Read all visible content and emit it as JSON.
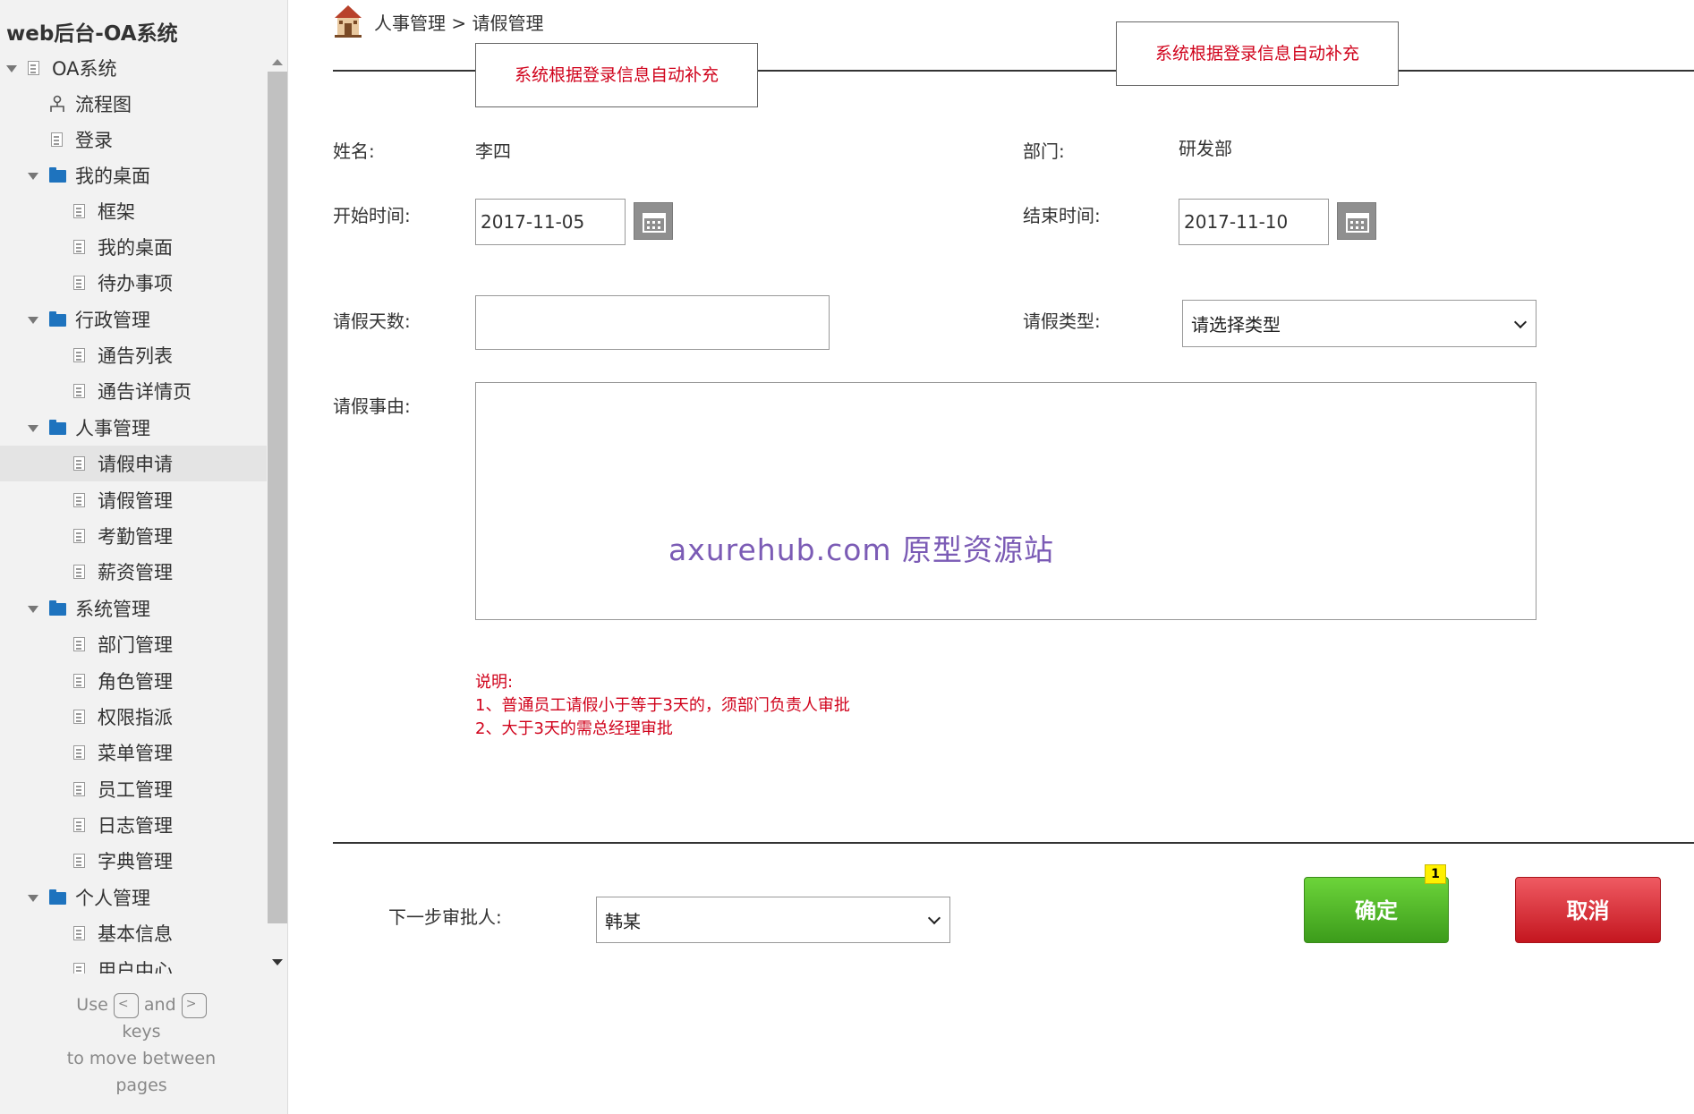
{
  "sidebar": {
    "app_title": "web后台-OA系统",
    "items": [
      {
        "label": "OA系统",
        "icon": "document-icon",
        "expander": "expanded"
      },
      {
        "label": "流程图",
        "icon": "flowchart-icon"
      },
      {
        "label": "登录",
        "icon": "document-icon"
      },
      {
        "label": "我的桌面",
        "icon": "folder-icon",
        "expander": "expanded"
      },
      {
        "label": "框架",
        "icon": "document-icon"
      },
      {
        "label": "我的桌面",
        "icon": "document-icon"
      },
      {
        "label": "待办事项",
        "icon": "document-icon"
      },
      {
        "label": "行政管理",
        "icon": "folder-icon",
        "expander": "expanded"
      },
      {
        "label": "通告列表",
        "icon": "document-icon"
      },
      {
        "label": "通告详情页",
        "icon": "document-icon"
      },
      {
        "label": "人事管理",
        "icon": "folder-icon",
        "expander": "expanded"
      },
      {
        "label": "请假申请",
        "icon": "document-icon",
        "selected": true
      },
      {
        "label": "请假管理",
        "icon": "document-icon"
      },
      {
        "label": "考勤管理",
        "icon": "document-icon"
      },
      {
        "label": "薪资管理",
        "icon": "document-icon"
      },
      {
        "label": "系统管理",
        "icon": "folder-icon",
        "expander": "expanded"
      },
      {
        "label": "部门管理",
        "icon": "document-icon"
      },
      {
        "label": "角色管理",
        "icon": "document-icon"
      },
      {
        "label": "权限指派",
        "icon": "document-icon"
      },
      {
        "label": "菜单管理",
        "icon": "document-icon"
      },
      {
        "label": "员工管理",
        "icon": "document-icon"
      },
      {
        "label": "日志管理",
        "icon": "document-icon"
      },
      {
        "label": "字典管理",
        "icon": "document-icon"
      },
      {
        "label": "个人管理",
        "icon": "folder-icon",
        "expander": "expanded"
      },
      {
        "label": "基本信息",
        "icon": "document-icon"
      },
      {
        "label": "用户中心",
        "icon": "document-icon"
      }
    ],
    "key_hint": {
      "use": "Use",
      "prev_key": "<",
      "and": "and",
      "next_key": ">",
      "keys": "keys",
      "to_move": "to move between",
      "pages": "pages"
    }
  },
  "header": {
    "breadcrumb": "人事管理 > 请假管理",
    "icon": "home-icon"
  },
  "callouts": {
    "left": "系统根据登录信息自动补充",
    "right": "系统根据登录信息自动补充"
  },
  "form": {
    "name_label": "姓名:",
    "name_value": "李四",
    "dept_label": "部门:",
    "dept_value": "研发部",
    "start_label": "开始时间:",
    "start_value": "2017-11-05",
    "end_label": "结束时间:",
    "end_value": "2017-11-10",
    "days_label": "请假天数:",
    "days_value": "",
    "type_label": "请假类型:",
    "type_value": "请选择类型",
    "reason_label": "请假事由:",
    "reason_value": ""
  },
  "watermark": "axurehub.com 原型资源站",
  "notes": {
    "title": "说明:",
    "line1": "1、普通员工请假小于等于3天的，须部门负责人审批",
    "line2": "2、大于3天的需总经理审批"
  },
  "footer": {
    "approver_label": "下一步审批人:",
    "approver_value": "韩某",
    "ok_label": "确定",
    "cancel_label": "取消",
    "badge": "1"
  },
  "colors": {
    "accent_red": "#d0021b",
    "ok_green": "#4caf2a",
    "cancel_red": "#d9252e",
    "folder_blue": "#1e73be",
    "watermark_purple": "#7b5bb5",
    "badge_yellow": "#fff000"
  }
}
